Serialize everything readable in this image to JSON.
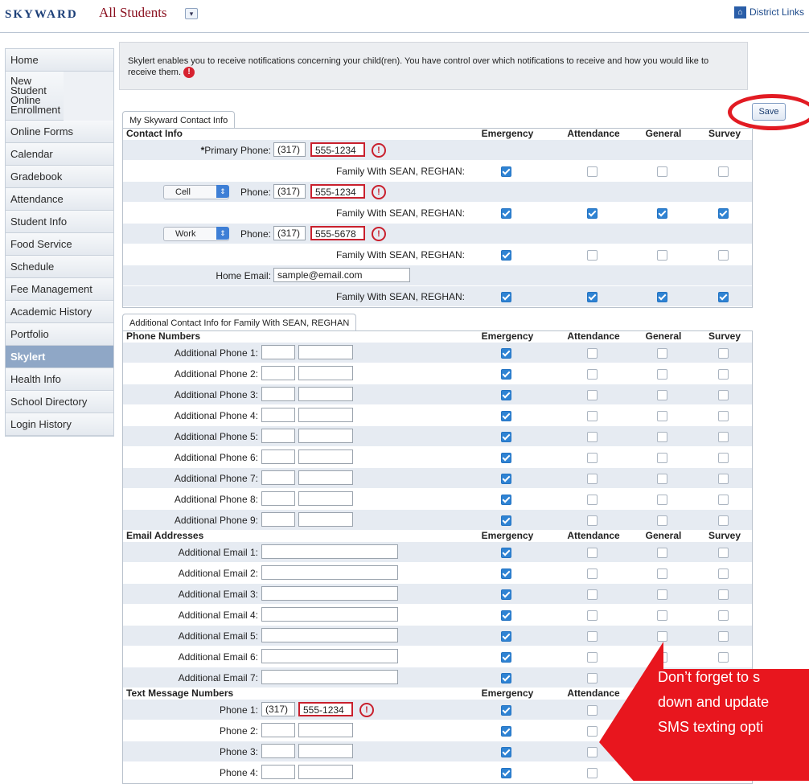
{
  "header": {
    "logo": "SKYWARD",
    "title": "All Students",
    "district_links": "District Links"
  },
  "sidebar": {
    "items": [
      {
        "label": "Home"
      },
      {
        "label": "New Student Online Enrollment"
      },
      {
        "label": "Online Forms"
      },
      {
        "label": "Calendar"
      },
      {
        "label": "Gradebook"
      },
      {
        "label": "Attendance"
      },
      {
        "label": "Student Info"
      },
      {
        "label": "Food Service"
      },
      {
        "label": "Schedule"
      },
      {
        "label": "Fee Management"
      },
      {
        "label": "Academic History"
      },
      {
        "label": "Portfolio"
      },
      {
        "label": "Skylert",
        "active": true
      },
      {
        "label": "Health Info"
      },
      {
        "label": "School Directory"
      },
      {
        "label": "Login History"
      }
    ]
  },
  "intro": {
    "text": "Skylert enables you to receive notifications concerning your child(ren). You have control over which notifications to receive and how you would like to receive them."
  },
  "save_label": "Save",
  "columns": [
    "Emergency",
    "Attendance",
    "General",
    "Survey"
  ],
  "contact": {
    "tab": "My Skyward Contact Info",
    "heading": "Contact Info",
    "family_label": "Family With SEAN, REGHAN:",
    "primary": {
      "label": "Primary Phone:",
      "area": "(317)",
      "number": "555-1234",
      "checks": [
        true,
        false,
        false,
        false
      ]
    },
    "phone2": {
      "type": "Cell",
      "label": "Phone:",
      "area": "(317)",
      "number": "555-1234",
      "checks": [
        true,
        true,
        true,
        true
      ]
    },
    "phone3": {
      "type": "Work",
      "label": "Phone:",
      "area": "(317)",
      "number": "555-5678",
      "checks": [
        true,
        false,
        false,
        false
      ]
    },
    "email": {
      "label": "Home Email:",
      "value": "sample@email.com",
      "checks": [
        true,
        true,
        true,
        true
      ]
    }
  },
  "additional": {
    "tab": "Additional Contact Info for Family With SEAN, REGHAN",
    "phones_heading": "Phone Numbers",
    "phones": [
      "Additional Phone 1:",
      "Additional Phone 2:",
      "Additional Phone 3:",
      "Additional Phone 4:",
      "Additional Phone 5:",
      "Additional Phone 6:",
      "Additional Phone 7:",
      "Additional Phone 8:",
      "Additional Phone 9:"
    ],
    "emails_heading": "Email Addresses",
    "emails": [
      "Additional Email 1:",
      "Additional Email 2:",
      "Additional Email 3:",
      "Additional Email 4:",
      "Additional Email 5:",
      "Additional Email 6:",
      "Additional Email 7:"
    ],
    "text_heading": "Text Message Numbers",
    "text_phones": [
      {
        "label": "Phone 1:",
        "area": "(317)",
        "number": "555-1234"
      },
      {
        "label": "Phone 2:",
        "area": "",
        "number": ""
      },
      {
        "label": "Phone 3:",
        "area": "",
        "number": ""
      },
      {
        "label": "Phone 4:",
        "area": "",
        "number": ""
      }
    ]
  },
  "callout": {
    "lines": [
      "Don’t forget to s",
      "down and update",
      "SMS texting opti"
    ]
  }
}
